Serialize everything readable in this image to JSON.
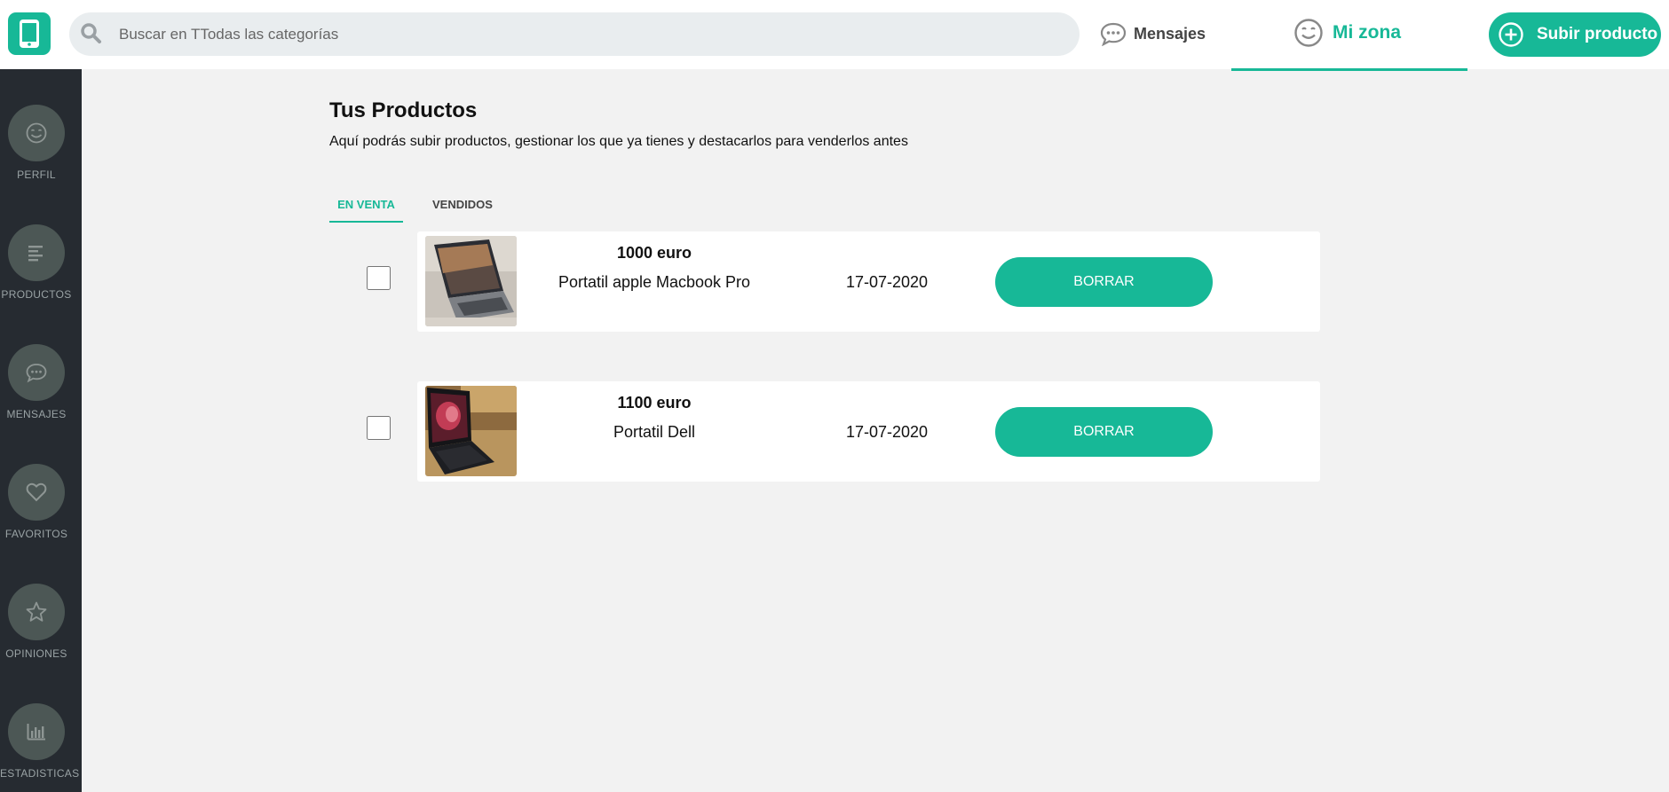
{
  "header": {
    "logo_icon": "phone-icon",
    "search_placeholder": "Buscar en TTodas las categorías",
    "messages_label": "Mensajes",
    "my_zone_label": "Mi zona",
    "upload_label": "Subir producto"
  },
  "sidebar": {
    "items": [
      {
        "label": "PERFIL",
        "icon": "smiley-icon"
      },
      {
        "label": "PRODUCTOS",
        "icon": "list-icon"
      },
      {
        "label": "MENSAJES",
        "icon": "chat-icon"
      },
      {
        "label": "FAVORITOS",
        "icon": "heart-icon"
      },
      {
        "label": "OPINIONES",
        "icon": "star-icon"
      },
      {
        "label": "ESTADISTICAS",
        "icon": "bar-chart-icon"
      }
    ]
  },
  "main": {
    "title": "Tus Productos",
    "subtitle": "Aquí podrás subir productos, gestionar los que ya tienes y destacarlos para venderlos antes",
    "tabs": [
      {
        "label": "EN VENTA",
        "active": true
      },
      {
        "label": "VENDIDOS",
        "active": false
      }
    ],
    "products": [
      {
        "price": "1000 euro",
        "name": "Portatil apple Macbook Pro",
        "date": "17-07-2020",
        "action": "BORRAR"
      },
      {
        "price": "1100 euro",
        "name": "Portatil Dell",
        "date": "17-07-2020",
        "action": "BORRAR"
      }
    ]
  },
  "colors": {
    "accent": "#17b897",
    "sidebar_bg": "#262b31",
    "page_bg": "#f2f2f2"
  }
}
